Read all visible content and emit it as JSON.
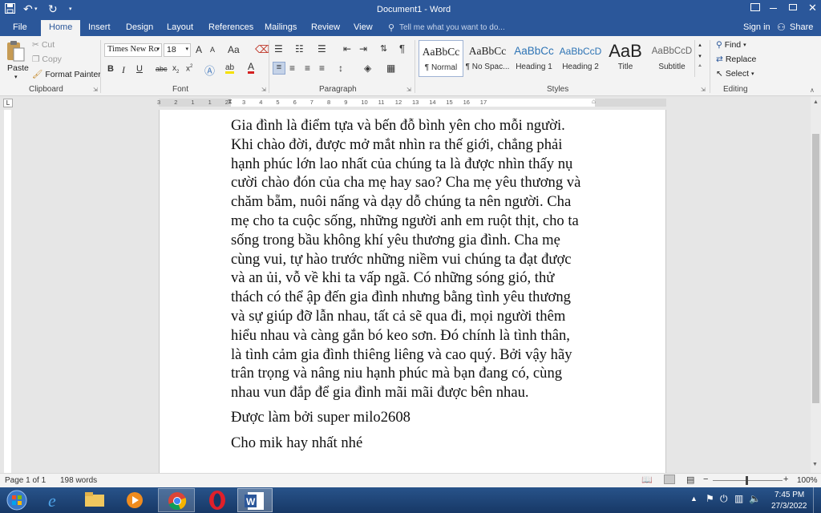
{
  "window": {
    "title": "Document1 - Word"
  },
  "quick_access": {
    "save": "save-icon",
    "undo": "undo-icon",
    "redo": "redo-icon"
  },
  "tabs": [
    "File",
    "Home",
    "Insert",
    "Design",
    "Layout",
    "References",
    "Mailings",
    "Review",
    "View"
  ],
  "tell_me": "Tell me what you want to do...",
  "account": {
    "sign_in": "Sign in",
    "share": "Share"
  },
  "clipboard": {
    "paste": "Paste",
    "cut": "Cut",
    "copy": "Copy",
    "format_painter": "Format Painter",
    "label": "Clipboard"
  },
  "font": {
    "name": "Times New Ro",
    "size": "18",
    "label": "Font",
    "grow": "A",
    "shrink": "A",
    "case": "Aa",
    "bold": "B",
    "italic": "I",
    "underline": "U",
    "strike": "abc",
    "sub": "x",
    "sup": "x",
    "color": "A",
    "highlight": "ab"
  },
  "paragraph": {
    "label": "Paragraph",
    "pilcrow": "¶"
  },
  "styles": {
    "label": "Styles",
    "items": [
      {
        "preview": "AaBbCc",
        "name": "¶ Normal"
      },
      {
        "preview": "AaBbCc",
        "name": "¶ No Spac..."
      },
      {
        "preview": "AaBbCc",
        "name": "Heading 1"
      },
      {
        "preview": "AaBbCcD",
        "name": "Heading 2"
      },
      {
        "preview": "AaB",
        "name": "Title"
      },
      {
        "preview": "AaBbCcD",
        "name": "Subtitle"
      }
    ]
  },
  "editing": {
    "find": "Find",
    "replace": "Replace",
    "select": "Select",
    "label": "Editing"
  },
  "ruler": {
    "numbers": [
      "3",
      "2",
      "1",
      "1",
      "2",
      "3",
      "4",
      "5",
      "6",
      "7",
      "8",
      "9",
      "10",
      "11",
      "12",
      "13",
      "14",
      "15",
      "16",
      "17"
    ]
  },
  "document": {
    "lines": [
      "Gia đình là điểm tựa và bến đỗ bình yên cho mỗi người.",
      "Khi chào đời, được mở mắt nhìn ra thế giới, chẳng phải",
      "hạnh phúc lớn lao nhất của chúng ta là được nhìn thấy nụ",
      "cười chào đón của cha mẹ hay sao? Cha mẹ yêu thương và",
      "chăm bẵm, nuôi nấng và dạy dỗ chúng ta nên người. Cha",
      "mẹ cho ta cuộc sống, những người anh em ruột thịt, cho ta",
      "sống trong bầu không khí yêu thương gia đình. Cha mẹ",
      "cùng vui, tự hào trước những niềm vui chúng ta đạt được",
      "và an ủi, vỗ về khi ta vấp ngã. Có những sóng gió, thử",
      "thách có thể ập đến gia đình nhưng bằng tình yêu thương",
      "và sự giúp đỡ lẫn nhau, tất cả sẽ qua đi, mọi người thêm",
      "hiểu nhau và càng gắn bó keo sơn. Đó chính là tình thân,",
      "là tình cảm gia đình thiêng liêng và cao quý. Bởi vậy hãy",
      "trân trọng và nâng niu hạnh phúc mà bạn đang có, cùng",
      "nhau vun đắp để gia đình mãi mãi được bên nhau."
    ],
    "line2": "Được làm bởi super milo2608",
    "line3": "Cho mik hay nhất nhé"
  },
  "status": {
    "page": "Page 1 of 1",
    "words": "198 words",
    "zoom": "100%",
    "zoom_minus": "−",
    "zoom_plus": "+"
  },
  "taskbar": {
    "time": "7:45 PM",
    "date": "27/3/2022",
    "apps": [
      "start-orb",
      "internet-explorer-icon",
      "file-explorer-icon",
      "media-player-icon",
      "chrome-icon",
      "opera-icon",
      "word-icon"
    ]
  },
  "colors": {
    "word_blue": "#2b579a",
    "ribbon": "#f3f3f3",
    "canvas": "#e6e6e6"
  }
}
